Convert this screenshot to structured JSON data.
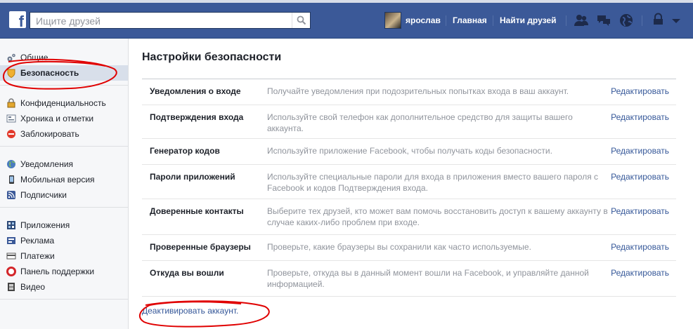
{
  "header": {
    "logo": "f",
    "search_placeholder": "Ищите друзей",
    "user_name": "ярослав",
    "home_label": "Главная",
    "find_friends_label": "Найти друзей",
    "icons": [
      "friend-requests-icon",
      "messages-icon",
      "notifications-globe-icon",
      "privacy-shortcuts-icon",
      "account-menu-chevron-icon"
    ]
  },
  "sidebar": {
    "groups": [
      [
        {
          "label": "Общие",
          "icon": "gear-icon"
        },
        {
          "label": "Безопасность",
          "icon": "shield-icon",
          "selected": true
        }
      ],
      [
        {
          "label": "Конфиденциальность",
          "icon": "lock-icon"
        },
        {
          "label": "Хроника и отметки",
          "icon": "timeline-icon"
        },
        {
          "label": "Заблокировать",
          "icon": "block-icon"
        }
      ],
      [
        {
          "label": "Уведомления",
          "icon": "globe-icon"
        },
        {
          "label": "Мобильная версия",
          "icon": "mobile-icon"
        },
        {
          "label": "Подписчики",
          "icon": "rss-icon"
        }
      ],
      [
        {
          "label": "Приложения",
          "icon": "apps-icon"
        },
        {
          "label": "Реклама",
          "icon": "ads-icon"
        },
        {
          "label": "Платежи",
          "icon": "payments-icon"
        },
        {
          "label": "Панель поддержки",
          "icon": "support-icon"
        },
        {
          "label": "Видео",
          "icon": "video-icon"
        }
      ]
    ]
  },
  "main": {
    "title": "Настройки безопасности",
    "edit_label": "Редактировать",
    "rows": [
      {
        "label": "Уведомления о входе",
        "desc": "Получайте уведомления при подозрительных попытках входа в ваш аккаунт."
      },
      {
        "label": "Подтверждения входа",
        "desc": "Используйте свой телефон как дополнительное средство для защиты вашего аккаунта."
      },
      {
        "label": "Генератор кодов",
        "desc": "Используйте приложение Facebook, чтобы получать коды безопасности."
      },
      {
        "label": "Пароли приложений",
        "desc": "Используйте специальные пароли для входа в приложения вместо вашего пароля с Facebook и кодов Подтверждения входа."
      },
      {
        "label": "Доверенные контакты",
        "desc": "Выберите тех друзей, кто может вам помочь восстановить доступ к вашему аккаунту в случае каких-либо проблем при входе."
      },
      {
        "label": "Проверенные браузеры",
        "desc": "Проверьте, какие браузеры вы сохранили как часто используемые."
      },
      {
        "label": "Откуда вы вошли",
        "desc": "Проверьте, откуда вы в данный момент вошли на Facebook, и управляйте данной информацией."
      }
    ],
    "deactivate_label": "Деактивировать аккаунт."
  },
  "colors": {
    "topbar": "#3b5998",
    "link": "#365899",
    "annotation": "#e00000"
  }
}
